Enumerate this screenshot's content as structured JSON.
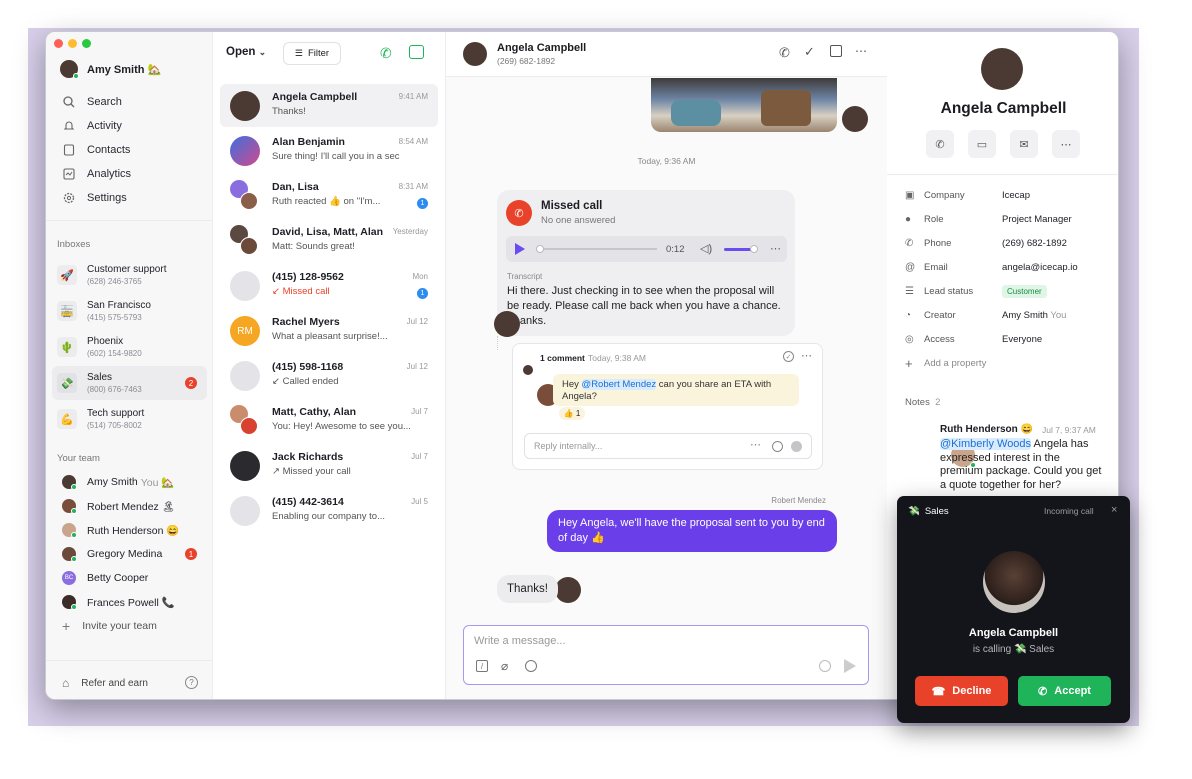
{
  "user": {
    "name": "Amy Smith 🏡"
  },
  "nav": [
    {
      "label": "Search"
    },
    {
      "label": "Activity"
    },
    {
      "label": "Contacts"
    },
    {
      "label": "Analytics"
    },
    {
      "label": "Settings"
    }
  ],
  "inboxes_title": "Inboxes",
  "inboxes": [
    {
      "name": "Customer support",
      "phone": "(628) 246-3765",
      "icon": "🚀"
    },
    {
      "name": "San Francisco",
      "phone": "(415) 575-5793",
      "icon": "🚋"
    },
    {
      "name": "Phoenix",
      "phone": "(602) 154-9820",
      "icon": "🌵"
    },
    {
      "name": "Sales",
      "phone": "(800) 676-7463",
      "icon": "💸",
      "badge": "2"
    },
    {
      "name": "Tech support",
      "phone": "(514) 705-8002",
      "icon": "💪"
    }
  ],
  "team_title": "Your team",
  "team": [
    {
      "name": "Amy Smith",
      "suffix": "You 🏡"
    },
    {
      "name": "Robert Mendez 🏝",
      "suffix": ""
    },
    {
      "name": "Ruth Henderson 😄",
      "suffix": ""
    },
    {
      "name": "Gregory Medina",
      "suffix": "",
      "badge": "1"
    },
    {
      "name": "Betty Cooper",
      "suffix": "",
      "initials": "BC"
    },
    {
      "name": "Frances Powell 📞",
      "suffix": ""
    }
  ],
  "invite": "Invite your team",
  "refer": "Refer and earn",
  "list": {
    "open": "Open",
    "filter": "Filter"
  },
  "conversations": [
    {
      "name": "Angela Campbell",
      "preview": "Thanks!",
      "time": "9:41 AM"
    },
    {
      "name": "Alan Benjamin",
      "preview": "Sure thing! I'll call you in a sec",
      "time": "8:54 AM"
    },
    {
      "name": "Dan, Lisa",
      "preview": "Ruth reacted 👍 on \"I'm...",
      "time": "8:31 AM"
    },
    {
      "name": "David, Lisa, Matt, Alan",
      "preview": "Matt: Sounds great!",
      "time": "Yesterday"
    },
    {
      "name": "(415) 128-9562",
      "preview": "↙ Missed call",
      "time": "Mon"
    },
    {
      "name": "Rachel Myers",
      "preview": "What a pleasant surprise!...",
      "time": "Jul 12",
      "initials": "RM"
    },
    {
      "name": "(415) 598-1168",
      "preview": "↙ Called ended",
      "time": "Jul 12"
    },
    {
      "name": "Matt, Cathy, Alan",
      "preview": "You: Hey! Awesome to see you...",
      "time": "Jul 7"
    },
    {
      "name": "Jack Richards",
      "preview": "↗ Missed your call",
      "time": "Jul 7"
    },
    {
      "name": "(415) 442-3614",
      "preview": "Enabling our company to...",
      "time": "Jul 5"
    }
  ],
  "chat": {
    "name": "Angela Campbell",
    "phone": "(269) 682-1892",
    "date": "Today, 9:36 AM",
    "missed_title": "Missed call",
    "missed_sub": "No one answered",
    "duration": "0:12",
    "transcript_label": "Transcript",
    "transcript": "Hi there. Just checking in to see when the proposal will be ready. Please call me back when you have a chance. Thanks.",
    "comment_count": "1 comment",
    "comment_time": "Today, 9:38 AM",
    "comment_pre": "Hey ",
    "comment_mention": "@Robert Mendez",
    "comment_post": " can you share an ETA with Angela?",
    "comment_reaction": "👍 1",
    "reply_placeholder": "Reply internally...",
    "sender": "Robert Mendez",
    "outgoing": "Hey Angela, we'll have the proposal sent to you by end of day 👍",
    "incoming": "Thanks!",
    "compose_placeholder": "Write a message..."
  },
  "contact": {
    "name": "Angela Campbell",
    "fields": [
      {
        "key": "Company",
        "value": "Icecap",
        "icon": "▣"
      },
      {
        "key": "Role",
        "value": "Project Manager",
        "icon": "●"
      },
      {
        "key": "Phone",
        "value": "(269) 682-1892",
        "icon": "✆"
      },
      {
        "key": "Email",
        "value": "angela@icecap.io",
        "icon": "@"
      },
      {
        "key": "Lead status",
        "value": "Customer",
        "icon": "☰"
      },
      {
        "key": "Creator",
        "value": "Amy Smith",
        "suffix": "You",
        "icon": "◔"
      },
      {
        "key": "Access",
        "value": "Everyone",
        "icon": "◎"
      }
    ],
    "add_property": "Add a property",
    "notes_label": "Notes",
    "notes_count": "2",
    "note_author": "Ruth Henderson 😄",
    "note_time": "Jul 7, 9:37 AM",
    "note_mention": "@Kimberly Woods",
    "note_text": " Angela has expressed interest in the premium package. Could you get a quote together for her?"
  },
  "call": {
    "inbox": "Sales",
    "inbox_icon": "💸",
    "status": "Incoming call",
    "name": "Angela Campbell",
    "calling": "is calling 💸 Sales",
    "decline": "Decline",
    "accept": "Accept",
    "decline_color": "#e8432a",
    "accept_color": "#1fb45a"
  }
}
